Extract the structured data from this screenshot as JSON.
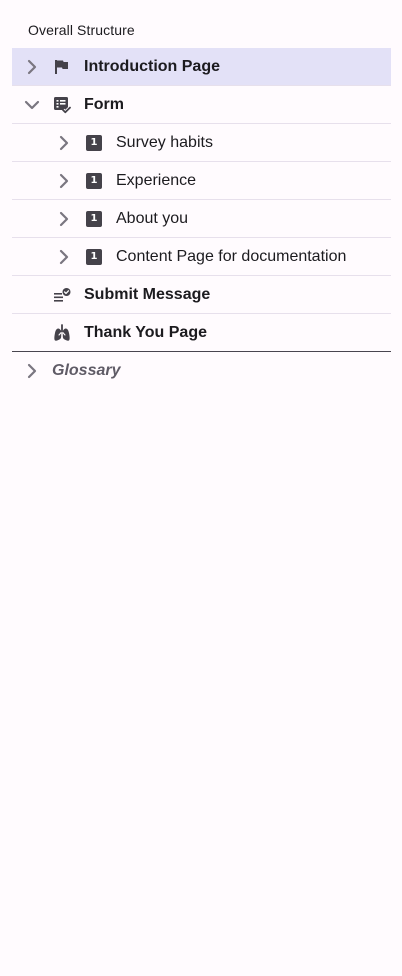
{
  "header": {
    "title": "Overall Structure"
  },
  "tree": {
    "introduction": {
      "label": "Introduction Page",
      "icon": "flag-icon",
      "expanded": false,
      "selected": true
    },
    "form": {
      "label": "Form",
      "icon": "form-checklist-icon",
      "expanded": true,
      "children": [
        {
          "label": "Survey habits",
          "badge": "1"
        },
        {
          "label": "Experience",
          "badge": "1"
        },
        {
          "label": "About you",
          "badge": "1"
        },
        {
          "label": "Content Page for documentation",
          "badge": "1"
        }
      ]
    },
    "submit": {
      "label": "Submit Message",
      "icon": "submit-list-check-icon"
    },
    "thankyou": {
      "label": "Thank You Page",
      "icon": "lungs-icon"
    },
    "glossary": {
      "label": "Glossary",
      "expanded": false
    }
  },
  "colors": {
    "selected_background": "#e3e1f7",
    "icon_dark": "#45424a",
    "chevron": "#7a7680"
  }
}
